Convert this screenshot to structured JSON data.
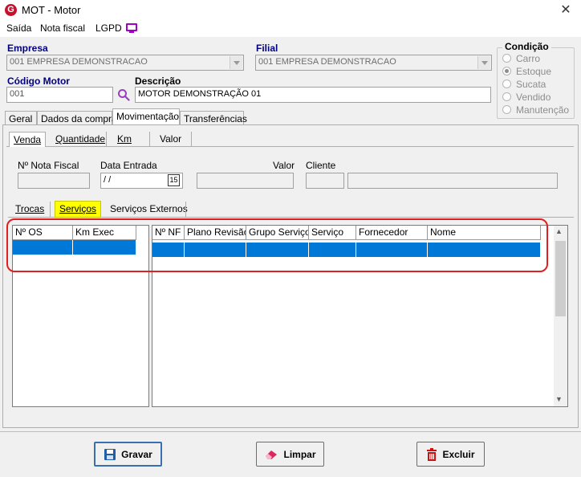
{
  "window": {
    "title": "MOT - Motor",
    "icon": "app-logo-icon",
    "close_glyph": "✕"
  },
  "menu": {
    "items": [
      "Saída",
      "Nota fiscal",
      "LGPD"
    ]
  },
  "form": {
    "empresa": {
      "label": "Empresa",
      "value": "001 EMPRESA DEMONSTRACAO"
    },
    "filial": {
      "label": "Filial",
      "value": "001 EMPRESA DEMONSTRACAO"
    },
    "codigo_motor": {
      "label": "Código Motor",
      "value": "001"
    },
    "descricao": {
      "label": "Descrição",
      "value": "MOTOR DEMONSTRAÇÃO 01"
    }
  },
  "condicao": {
    "label": "Condição",
    "options": [
      "Carro",
      "Estoque",
      "Sucata",
      "Vendido",
      "Manutenção"
    ],
    "selected": "Estoque"
  },
  "tabs": [
    "Geral",
    "Dados da compra",
    "Movimentação",
    "Transferências"
  ],
  "active_tab": "Movimentação",
  "subtabs": [
    "Venda",
    "Quantidade",
    "Km",
    "Valor"
  ],
  "active_subtab": "Venda",
  "venda": {
    "nota_fiscal_label": "Nº Nota Fiscal",
    "data_entrada_label": "Data Entrada",
    "data_entrada_value": " /  /",
    "valor_label": "Valor",
    "cliente_label": "Cliente"
  },
  "service_tabs": [
    "Trocas",
    "Serviços",
    "Serviços Externos"
  ],
  "active_service_tab": "Serviços",
  "left_grid": {
    "columns": [
      "Nº OS",
      "Km Exec"
    ]
  },
  "right_grid": {
    "columns": [
      "Nº NF",
      "Plano Revisão",
      "Grupo Serviço",
      "Serviço",
      "Fornecedor",
      "Nome"
    ]
  },
  "buttons": {
    "gravar": "Gravar",
    "limpar": "Limpar",
    "excluir": "Excluir"
  },
  "colors": {
    "accent_blue": "#000080",
    "selection": "#0078d7",
    "highlight_tab": "#ffff00",
    "annotation_red": "#e02020",
    "monitor_icon": "#a000c8"
  }
}
